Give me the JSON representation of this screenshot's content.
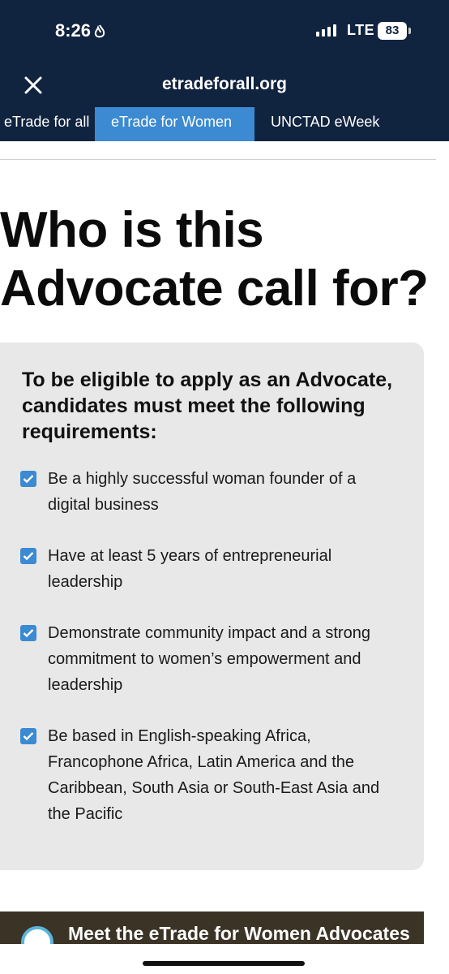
{
  "status_bar": {
    "time": "8:26",
    "network": "LTE",
    "battery": "83"
  },
  "browser": {
    "url": "etradeforall.org"
  },
  "nav": {
    "items": [
      "eTrade for all",
      "eTrade for Women",
      "UNCTAD eWeek"
    ],
    "active_index": 1
  },
  "page": {
    "title": "Who is this Advocate call for?"
  },
  "card": {
    "heading": "To be eligible to apply as an Advocate, candidates must meet the following requirements:",
    "requirements": [
      "Be a highly successful woman founder of a digital business",
      "Have at least 5 years of entrepreneurial leadership",
      "Demonstrate community impact and a strong commitment to women’s empowerment and leadership",
      "Be based in English-speaking Africa, Francophone Africa, Latin America and the Caribbean, South Asia or South-East Asia and the Pacific"
    ]
  },
  "banner": {
    "text": "Meet the eTrade for Women Advocates"
  },
  "colors": {
    "header_bg": "#10233f",
    "accent": "#3c8ad1",
    "card_bg": "#e8e8e8"
  },
  "icons": [
    "flame-icon",
    "signal-icon",
    "battery-icon",
    "close-icon",
    "checkbox-checked-icon"
  ]
}
